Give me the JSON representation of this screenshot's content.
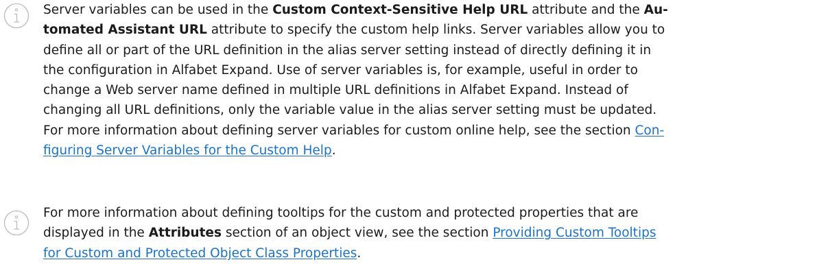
{
  "notes": [
    {
      "icon": "info-icon",
      "t1": "Server variables can be used in the ",
      "b1": "Custom Context-Sensitive Help URL",
      "t2": " attribute and the ",
      "b2a": "Au-",
      "b2b": "tomated Assistant URL",
      "t3": " attribute to specify the custom help links. Server variables allow you to",
      "t4": "define all or part of the URL definition in the alias server setting instead of directly defining it in",
      "t5": "the configuration in Alfabet Expand. Use of server variables is, for example, useful in order to",
      "t6": "change a Web server name defined in multiple URL definitions in Alfabet Expand. Instead of",
      "t7": "changing all URL definitions, only the variable value in the alias server setting must be updated.",
      "t8": "For more information about defining server variables for custom online help, see the section ",
      "link_a": "Con-",
      "link_b": "figuring Server Variables for the Custom Help",
      "t9": "."
    },
    {
      "icon": "info-icon",
      "t1": "For more information about defining tooltips for the custom and protected properties that are",
      "t2": "displayed in the ",
      "b1": "Attributes",
      "t3": " section of an object view, see the section ",
      "link_a": "Providing Custom Tooltips",
      "link_b": "for Custom and Protected Object Class Properties",
      "t4": "."
    }
  ]
}
